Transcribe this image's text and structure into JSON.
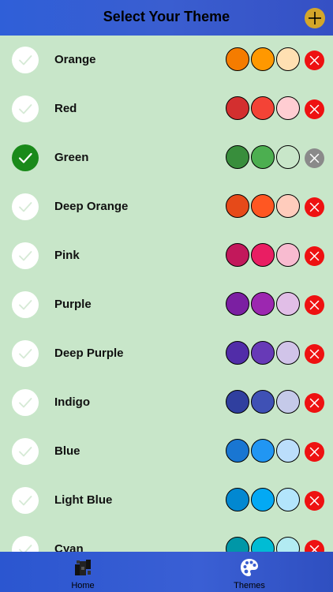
{
  "header": {
    "title": "Select Your Theme"
  },
  "themes": [
    {
      "name": "Orange",
      "selected": false,
      "colors": [
        "#f57c00",
        "#ff9800",
        "#ffe0b2"
      ]
    },
    {
      "name": "Red",
      "selected": false,
      "colors": [
        "#d32f2f",
        "#f44336",
        "#ffcdd2"
      ]
    },
    {
      "name": "Green",
      "selected": true,
      "colors": [
        "#388e3c",
        "#4caf50",
        "#c8e6c9"
      ]
    },
    {
      "name": "Deep Orange",
      "selected": false,
      "colors": [
        "#e64a19",
        "#ff5722",
        "#ffccbc"
      ]
    },
    {
      "name": "Pink",
      "selected": false,
      "colors": [
        "#c2185b",
        "#e91e63",
        "#f8bbd0"
      ]
    },
    {
      "name": "Purple",
      "selected": false,
      "colors": [
        "#7b1fa2",
        "#9c27b0",
        "#e1bee7"
      ]
    },
    {
      "name": "Deep Purple",
      "selected": false,
      "colors": [
        "#512da8",
        "#673ab7",
        "#d1c4e9"
      ]
    },
    {
      "name": "Indigo",
      "selected": false,
      "colors": [
        "#303f9f",
        "#3f51b5",
        "#c5cae9"
      ]
    },
    {
      "name": "Blue",
      "selected": false,
      "colors": [
        "#1976d2",
        "#2196f3",
        "#bbdefb"
      ]
    },
    {
      "name": "Light Blue",
      "selected": false,
      "colors": [
        "#0288d1",
        "#03a9f4",
        "#b3e5fc"
      ]
    },
    {
      "name": "Cyan",
      "selected": false,
      "colors": [
        "#0097a7",
        "#00bcd4",
        "#b2ebf2"
      ]
    }
  ],
  "tabs": {
    "home": {
      "label": "Home",
      "icon": "home-icon"
    },
    "themes": {
      "label": "Themes",
      "icon": "palette-icon"
    }
  },
  "colors": {
    "background": "#c8e6c9",
    "bar": "#3a5ed0",
    "accent": "#d4a62a",
    "selected": "#1a8a1a",
    "delete": "#ee1111",
    "delete_disabled": "#8a8a8a"
  }
}
